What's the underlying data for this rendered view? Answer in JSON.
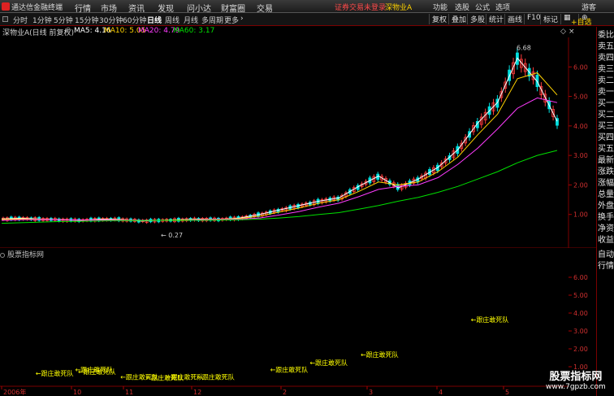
{
  "app": {
    "title": "通达信金融终端",
    "menus": [
      "行情",
      "市场",
      "资讯",
      "发现",
      "问小达",
      "财富圈",
      "交易"
    ],
    "status": "证券交易未登录",
    "stock": "深物业A",
    "right_menus": [
      "功能",
      "选股",
      "公式",
      "选项",
      "游客"
    ]
  },
  "toolbar": {
    "periods": [
      "分时",
      "1分钟",
      "5分钟",
      "15分钟",
      "30分钟",
      "60分钟",
      "日线",
      "周线",
      "月线",
      "多周期",
      "更多"
    ],
    "active_period": "日线",
    "tools": [
      "复权",
      "叠加",
      "多股",
      "统计",
      "画线",
      "F10",
      "标记"
    ]
  },
  "main_chart": {
    "label": "深物业A(日线 前复权)",
    "ma": [
      {
        "label": "MA5: 4.16",
        "color": "#ffffff"
      },
      {
        "label": "MA10: 5.05",
        "color": "#ffd200"
      },
      {
        "label": "MA20: 4.79",
        "color": "#ff3cff"
      },
      {
        "label": "MA60: 3.17",
        "color": "#00e000"
      }
    ],
    "high_label": "6.68",
    "low_label": "0.27"
  },
  "sidebar1": {
    "top_button": "+自选",
    "items": [
      "委比",
      "卖五",
      "卖四",
      "卖三",
      "卖二",
      "卖一",
      "买一",
      "买二",
      "买三",
      "买四",
      "买五",
      "最新",
      "涨跌",
      "涨幅",
      "总量",
      "外盘",
      "换手",
      "净资",
      "收益"
    ]
  },
  "sidebar2": {
    "items": [
      "自动",
      "行情"
    ]
  },
  "indicator": {
    "label": "股票指标网",
    "signal_text": "←跟庄敢死队"
  },
  "chart_data": [
    {
      "type": "candlestick",
      "title": "深物业A(日线 前复权)",
      "y_ticks": [
        "6.00",
        "5.00",
        "4.00",
        "3.00",
        "2.00",
        "1.00"
      ],
      "ylim": [
        0,
        7
      ],
      "max": 6.68,
      "min": 0.27,
      "series": [
        {
          "name": "MA5",
          "values": [
            0.85,
            0.87,
            0.84,
            0.82,
            0.8,
            0.84,
            0.83,
            0.78,
            0.8,
            0.82,
            0.84,
            0.83,
            0.88,
            1.0,
            1.15,
            1.3,
            1.45,
            1.56,
            1.95,
            2.3,
            1.9,
            2.2,
            2.6,
            3.2,
            4.1,
            4.8,
            6.3,
            5.5,
            4.16
          ]
        },
        {
          "name": "MA10",
          "values": [
            0.83,
            0.85,
            0.84,
            0.82,
            0.81,
            0.82,
            0.82,
            0.8,
            0.8,
            0.81,
            0.83,
            0.84,
            0.86,
            0.94,
            1.08,
            1.22,
            1.38,
            1.5,
            1.78,
            2.1,
            2.0,
            2.1,
            2.45,
            2.95,
            3.7,
            4.4,
            5.6,
            5.8,
            5.05
          ]
        },
        {
          "name": "MA20",
          "values": [
            0.8,
            0.82,
            0.83,
            0.82,
            0.81,
            0.81,
            0.81,
            0.8,
            0.8,
            0.8,
            0.82,
            0.83,
            0.84,
            0.88,
            0.98,
            1.1,
            1.25,
            1.38,
            1.6,
            1.85,
            1.95,
            2.0,
            2.25,
            2.7,
            3.25,
            3.9,
            4.6,
            4.95,
            4.79
          ]
        },
        {
          "name": "MA60",
          "values": [
            0.7,
            0.72,
            0.74,
            0.76,
            0.77,
            0.78,
            0.79,
            0.79,
            0.8,
            0.8,
            0.8,
            0.81,
            0.82,
            0.84,
            0.88,
            0.93,
            1.0,
            1.06,
            1.18,
            1.3,
            1.45,
            1.58,
            1.75,
            1.95,
            2.2,
            2.45,
            2.75,
            3.0,
            3.17
          ]
        }
      ]
    },
    {
      "type": "line",
      "title": "股票指标网",
      "y_ticks": [
        "6.00",
        "5.00",
        "4.00",
        "3.00",
        "2.00",
        "1.00"
      ],
      "ylim": [
        0,
        7
      ],
      "x_ticks": [
        "2006年",
        "10",
        "11",
        "12",
        "2",
        "3",
        "4",
        "5"
      ],
      "signals": [
        {
          "label": "←跟庄敢死队",
          "x": 0.06,
          "y": 0.5
        },
        {
          "label": "←跟庄敢死队",
          "x": 0.13,
          "y": 0.7
        },
        {
          "label": "←跟庄敢死队",
          "x": 0.135,
          "y": 0.6
        },
        {
          "label": "←跟庄敢死队",
          "x": 0.21,
          "y": 0.3
        },
        {
          "label": "←跟庄敢死队",
          "x": 0.255,
          "y": 0.25
        },
        {
          "label": "←跟庄敢死队",
          "x": 0.29,
          "y": 0.3
        },
        {
          "label": "←跟庄敢死队",
          "x": 0.345,
          "y": 0.3
        },
        {
          "label": "←跟庄敢死队",
          "x": 0.475,
          "y": 0.7
        },
        {
          "label": "←跟庄敢死队",
          "x": 0.545,
          "y": 1.1
        },
        {
          "label": "←跟庄敢死队",
          "x": 0.635,
          "y": 1.55
        },
        {
          "label": "←跟庄敢死队",
          "x": 0.83,
          "y": 3.5
        }
      ]
    }
  ]
}
